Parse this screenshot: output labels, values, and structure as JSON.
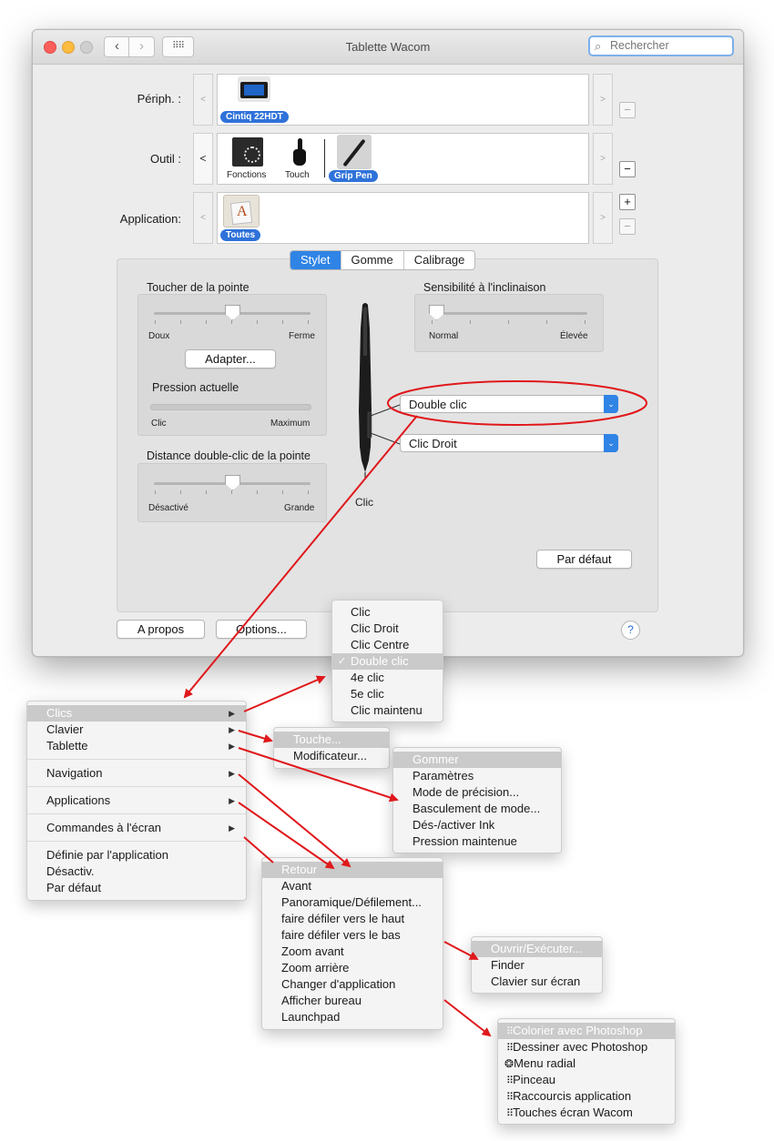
{
  "window": {
    "title": "Tablette Wacom",
    "search_placeholder": "Rechercher"
  },
  "rows": {
    "device_label": "Périph. :",
    "tool_label": "Outil :",
    "app_label": "Application:",
    "device_item": "Cintiq 22HDT",
    "tool_items": [
      "Fonctions",
      "Touch",
      "Grip Pen"
    ],
    "app_item": "Toutes"
  },
  "tabs": [
    "Stylet",
    "Gomme",
    "Calibrage"
  ],
  "tip_feel": {
    "title": "Toucher de la pointe",
    "left": "Doux",
    "right": "Ferme",
    "adjust_button": "Adapter...",
    "pressure_title": "Pression actuelle",
    "pressure_left": "Clic",
    "pressure_right": "Maximum"
  },
  "tilt": {
    "title": "Sensibilité à l'inclinaison",
    "left": "Normal",
    "right": "Élevée"
  },
  "double_click": {
    "title": "Distance double-clic de la pointe",
    "left": "Désactivé",
    "right": "Grande"
  },
  "pen": {
    "upper_button": "Double clic",
    "lower_button": "Clic Droit",
    "tip_label": "Clic"
  },
  "default_button": "Par défaut",
  "about_button": "A propos",
  "options_button": "Options...",
  "help_label": "?",
  "menus": {
    "main": {
      "items": [
        "Clics",
        "Clavier",
        "Tablette",
        "Navigation",
        "Applications",
        "Commandes à l'écran",
        "Définie par l'application",
        "Désactiv.",
        "Par défaut"
      ]
    },
    "clicks": {
      "items": [
        "Clic",
        "Clic Droit",
        "Clic Centre",
        "Double clic",
        "4e clic",
        "5e clic",
        "Clic maintenu"
      ],
      "checkmark": "✓"
    },
    "keyboard": {
      "items": [
        "Touche...",
        "Modificateur..."
      ]
    },
    "tablet": {
      "items": [
        "Gommer",
        "Paramètres",
        "Mode de précision...",
        "Basculement de mode...",
        "Dés-/activer Ink",
        "Pression maintenue"
      ]
    },
    "navigation": {
      "items": [
        "Retour",
        "Avant",
        "Panoramique/Défilement...",
        "faire défiler vers le haut",
        "faire défiler vers le bas",
        "Zoom avant",
        "Zoom arrière",
        "Changer d'application",
        "Afficher bureau",
        "Launchpad"
      ]
    },
    "applications": {
      "items": [
        "Ouvrir/Exécuter...",
        "Finder",
        "Clavier sur écran"
      ]
    },
    "onscreen": {
      "items": [
        "Colorier avec Photoshop",
        "Dessiner avec Photoshop",
        "Menu radial",
        "Pinceau",
        "Raccourcis application",
        "Touches écran Wacom"
      ]
    }
  },
  "colors": {
    "accent": "#2f84e6",
    "annotation": "#e0181b"
  }
}
